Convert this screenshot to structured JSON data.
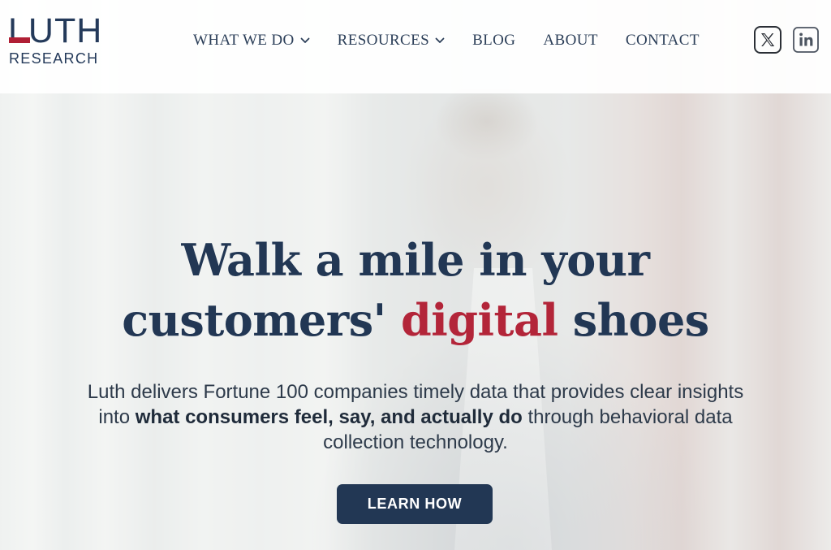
{
  "logo": {
    "primary": "LUTH",
    "secondary": "RESEARCH"
  },
  "nav": {
    "items": [
      {
        "label": "WHAT WE DO",
        "has_dropdown": true
      },
      {
        "label": "RESOURCES",
        "has_dropdown": true
      },
      {
        "label": "BLOG",
        "has_dropdown": false
      },
      {
        "label": "ABOUT",
        "has_dropdown": false
      },
      {
        "label": "CONTACT",
        "has_dropdown": false
      }
    ]
  },
  "social": {
    "icons": [
      "x-icon",
      "linkedin-icon"
    ]
  },
  "hero": {
    "headline_line1": "Walk a mile in your",
    "headline_line2_before": "customers' ",
    "headline_line2_accent": "digital",
    "headline_line2_after": " shoes",
    "sub_before": "Luth delivers Fortune 100 companies timely data that provides clear insights into ",
    "sub_bold": "what consumers feel, say, and actually do",
    "sub_after": " through behavioral data collection technology.",
    "cta_label": "LEARN HOW"
  },
  "colors": {
    "brand_navy": "#223754",
    "brand_red": "#b32539",
    "header_bg": "#ffffff"
  }
}
